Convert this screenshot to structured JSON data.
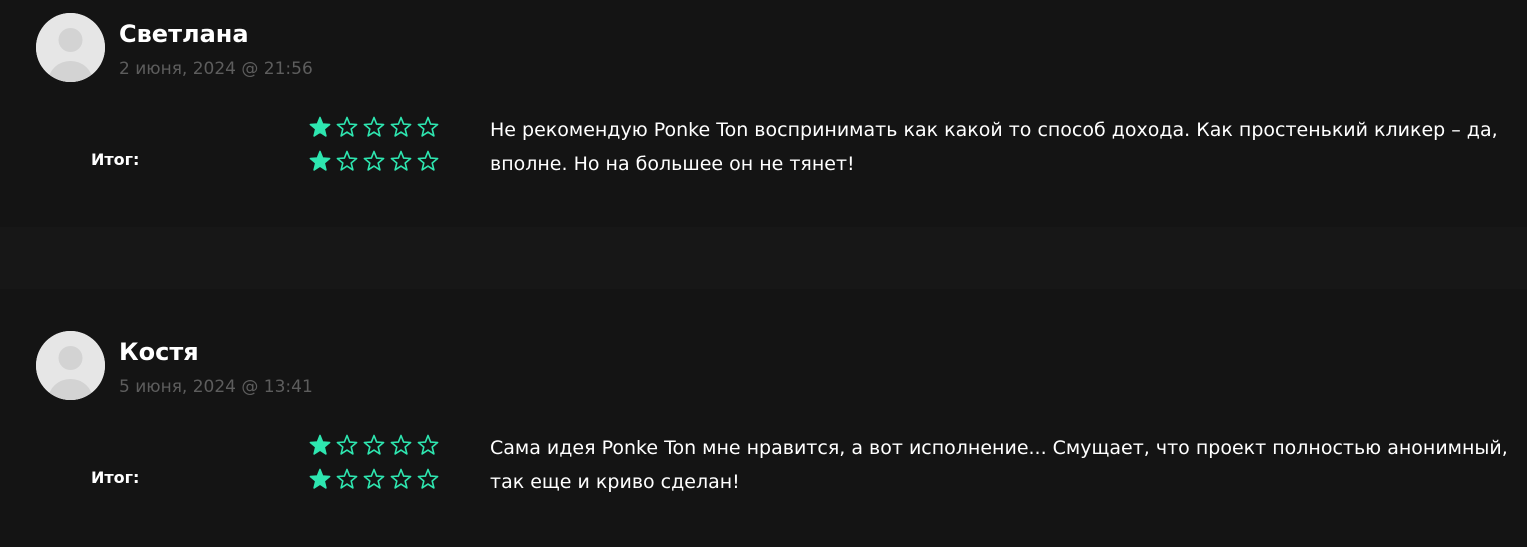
{
  "reviews": [
    {
      "author": "Светлана",
      "date": "2 июня, 2024 @ 21:56",
      "rating_row1": 1,
      "rating_total": 1,
      "rating_max": 5,
      "total_label": "Итог:",
      "comment": "Не рекомендую Ponke Ton воспринимать как какой то способ дохода. Как простенький кликер – да, вполне. Но на большее он не тянет!"
    },
    {
      "author": "Костя",
      "date": "5 июня, 2024 @ 13:41",
      "rating_row1": 1,
      "rating_total": 1,
      "rating_max": 5,
      "total_label": "Итог:",
      "comment": "Сама идея Ponke Ton мне нравится, а вот исполнение... Смущает, что проект полностью анонимный, так еще и криво сделан!"
    }
  ],
  "colors": {
    "star": "#2ee6b0",
    "background": "#141414",
    "date": "#5d5d5d"
  },
  "icons": {
    "avatar": "user-placeholder-icon",
    "star_filled": "star-filled-icon",
    "star_empty": "star-outline-icon"
  }
}
